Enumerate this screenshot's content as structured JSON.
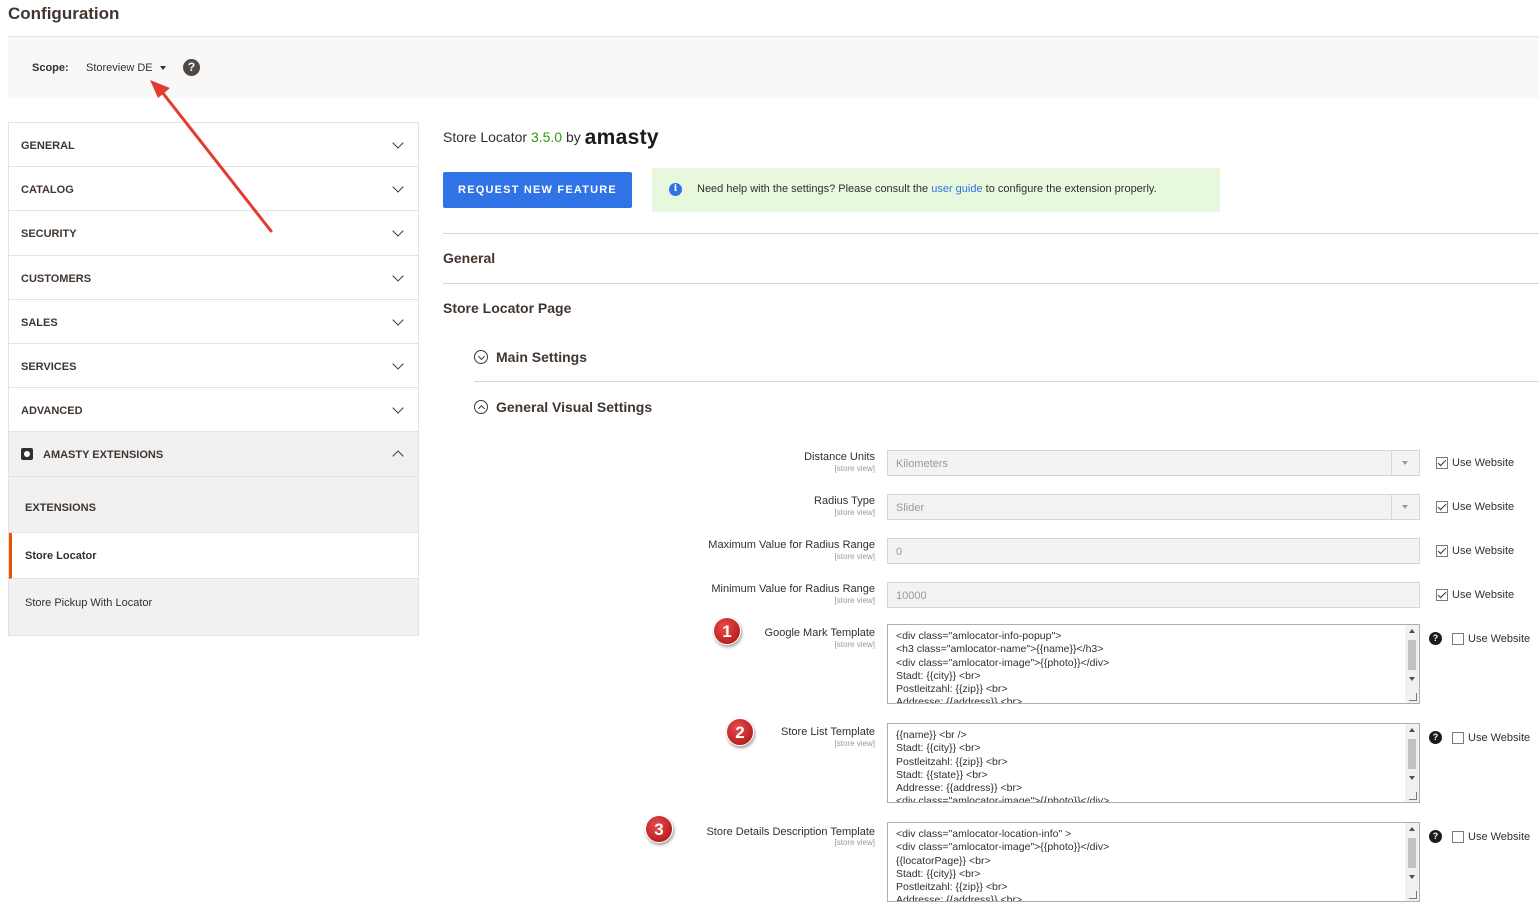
{
  "page": {
    "title": "Configuration"
  },
  "scope": {
    "label": "Scope:",
    "value": "Storeview DE",
    "help": "?"
  },
  "sidebar": {
    "items": [
      {
        "label": "GENERAL"
      },
      {
        "label": "CATALOG"
      },
      {
        "label": "SECURITY"
      },
      {
        "label": "CUSTOMERS"
      },
      {
        "label": "SALES"
      },
      {
        "label": "SERVICES"
      },
      {
        "label": "ADVANCED"
      }
    ],
    "amasty": {
      "label": "AMASTY EXTENSIONS"
    },
    "extensions_header": "EXTENSIONS",
    "active_item": "Store Locator",
    "secondary_item": "Store Pickup With Locator"
  },
  "main": {
    "ext_name": "Store Locator",
    "version": "3.5.0",
    "by": "by",
    "brand": "amasty",
    "request_button": "REQUEST NEW FEATURE",
    "notice": {
      "icon": "i",
      "before": "Need help with the settings? Please consult the ",
      "link": "user guide",
      "after": " to configure the extension properly."
    },
    "section_general": "General",
    "section_store_locator_page": "Store Locator Page",
    "group_main": "Main Settings",
    "group_visual": "General Visual Settings"
  },
  "fields": {
    "distance_units": {
      "label": "Distance Units",
      "scope": "[store view]",
      "value": "Kilometers",
      "use_website": "Use Website"
    },
    "radius_type": {
      "label": "Radius Type",
      "scope": "[store view]",
      "value": "Slider",
      "use_website": "Use Website"
    },
    "max_radius": {
      "label": "Maximum Value for Radius Range",
      "scope": "[store view]",
      "value": "0",
      "use_website": "Use Website"
    },
    "min_radius": {
      "label": "Minimum Value for Radius Range",
      "scope": "[store view]",
      "value": "10000",
      "use_website": "Use Website"
    },
    "google_mark": {
      "label": "Google Mark Template",
      "scope": "[store view]",
      "use_website": "Use Website",
      "help": "?",
      "value": "<div class=\"amlocator-info-popup\">\n<h3 class=\"amlocator-name\">{{name}}</h3>\n<div class=\"amlocator-image\">{{photo}}</div>\nStadt: {{city}} <br>\nPostleitzahl: {{zip}} <br>\nAddresse: {{address}} <br>"
    },
    "store_list": {
      "label": "Store List Template",
      "scope": "[store view]",
      "use_website": "Use Website",
      "help": "?",
      "value": "{{name}} <br />\nStadt: {{city}} <br>\nPostleitzahl: {{zip}} <br>\nStadt: {{state}} <br>\nAddresse: {{address}} <br>\n<div class=\"amlocator-image\">{{photo}}</div>"
    },
    "store_details": {
      "label": "Store Details Description Template",
      "scope": "[store view]",
      "use_website": "Use Website",
      "help": "?",
      "value": "<div class=\"amlocator-location-info\" >\n<div class=\"amlocator-image\">{{photo}}</div>\n{{locatorPage}} <br>\nStadt: {{city}} <br>\nPostleitzahl: {{zip}} <br>\nAddresse: {{address}} <br>"
    }
  },
  "annotations": {
    "badge1": "1",
    "badge2": "2",
    "badge3": "3",
    "arrow_color": "#e03c31"
  }
}
